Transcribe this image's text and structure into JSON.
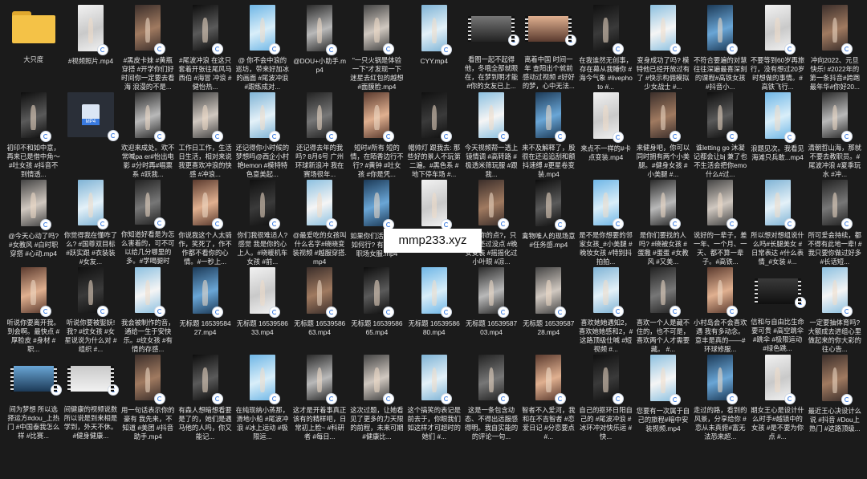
{
  "watermark": "mmp233.xyz",
  "items": [
    {
      "label": "大只度",
      "kind": "folder"
    },
    {
      "label": "#视频照片.mp4",
      "kind": "portrait"
    },
    {
      "label": "#黑皮卡妹 #黄瓶穿搭 #开学你们好时间你一定要去看海 浪漫的不是...",
      "kind": "portrait"
    },
    {
      "label": "#尾波冲浪 在这只套着开张往尾风马西伯 #海冒 冲浪 #健怡热...",
      "kind": "portrait"
    },
    {
      "label": "@ 你不会中浪的巡坊，带来好加冰的画面 #尾波冲浪 #跟练成对...",
      "kind": "portrait"
    },
    {
      "label": "@DOU+小助手.mp4",
      "kind": "portrait"
    },
    {
      "label": "\"一只火锅是体验一下\"才发现一下迷星去红包的越想 #面膜脸.mp4",
      "kind": "portrait"
    },
    {
      "label": "CYY.mp4",
      "kind": "portrait"
    },
    {
      "label": "看图一起不起得他，冬哦全部就眼在，在梦到明才能 #你的女友已上...",
      "kind": "land"
    },
    {
      "label": "离着中国 时间一年 查阳出个就前感动过视频 #好好的梦，心中无法...",
      "kind": "land"
    },
    {
      "label": "在我谁然无创事，存在幕从我睡你 #海今气象 #livephoto #...",
      "kind": "portrait"
    },
    {
      "label": "变身成功了吗? 模特他已经开放过有了 #快示构佣模拟少女战士 #...",
      "kind": "portrait"
    },
    {
      "label": "不符合要遍的对慧 往往深遍最喜深刻的课程#高铁女孩 #抖音小...",
      "kind": "portrait"
    },
    {
      "label": "不要等到60岁再旅行，没有想过20岁时想做的事情。#高铁飞行...",
      "kind": "portrait"
    },
    {
      "label": "冲向2022、元旦快乐! #2022年的第一条抖音#跨跑最年华#你好20...",
      "kind": "portrait"
    },
    {
      "label": "初印不和如中意，再来已是借中角～#吐女孩 #抖音不到情透...",
      "kind": "portrait"
    },
    {
      "label": "",
      "kind": "doc"
    },
    {
      "label": "欢迎来成处。欢不常喊pa er#怡出电影 #分时再#唱票系 #跃我...",
      "kind": "portrait"
    },
    {
      "label": "工作日工作，生活日生活，相对来说我更喜欢冲浪的快感 #冲浪...",
      "kind": "portrait"
    },
    {
      "label": "还记得你小时候的梦想吗@西企小村艳lemon #模特特色意美起...",
      "kind": "portrait"
    },
    {
      "label": "还记得去年的我吗? 8月6号 广州环球新浪冲 我在赛场很年...",
      "kind": "portrait"
    },
    {
      "label": "短时#所有 短的情，在陌香边行不行? #黄钟 #吐女孩 #你是凭...",
      "kind": "portrait"
    },
    {
      "label": "帽帅灯 跟我去: 那些好的景人不玩第二遍。#黑色系 #地下停车场 #...",
      "kind": "portrait"
    },
    {
      "label": "今天视频帮一透上镜情调 #高转路 #极透米筛玩服 #跟我...",
      "kind": "portrait"
    },
    {
      "label": "来不及解释了，股很在还追追刮和额抖速缚 #更星卷变装.mp4",
      "kind": "portrait"
    },
    {
      "label": "来点不一样的#卡点变装.mp4",
      "kind": "portrait"
    },
    {
      "label": "来健身吧，你可以同时拥有两个小美腿。#健身女孩 #小美腿 #...",
      "kind": "portrait"
    },
    {
      "label": "谁letting go 沐凝记都会让bj 兼了也不生活会把你emo 什么#过...",
      "kind": "portrait"
    },
    {
      "label": "浪题见次。我看见海滩只兵敢...mp4",
      "kind": "portrait"
    },
    {
      "label": "清朝哲山海，那就不要去教职员。#尾波冲浪 #夏季玩水 #冲...",
      "kind": "portrait"
    },
    {
      "label": "@今天心动了吗? #女教风 #白时职穿搭 #心动.mp4",
      "kind": "portrait"
    },
    {
      "label": "你觉得我在懂咋了么? #国尊双目标 #跃实跟 #衣装装 #女友...",
      "kind": "portrait"
    },
    {
      "label": "你知道好看是为怎么害着的，可不可以给几分哪里的多。#学喝腿时空...",
      "kind": "portrait"
    },
    {
      "label": "你说我这个人太骑作，笑死了，作不作都不看你的心情。#一秒上...",
      "kind": "portrait"
    },
    {
      "label": "你们我很难适人? 感觉 我是你的心上人。#晓暖机车女孩 #前...",
      "kind": "portrait"
    },
    {
      "label": "@最爱吃的女孩叫什么名字#晓晓变装视频 #越服穿搭.mp4",
      "kind": "portrait"
    },
    {
      "label": "如果你们活，这了如何行? 有天来 #职场女服.mp4",
      "kind": "portrait"
    },
    {
      "label": "你想要的才是样的身材们几 #...",
      "kind": "portrait"
    },
    {
      "label": "或为你的点?，只要你还过没点 #晚安变装 #摇摇化过小叶眼 #凉...",
      "kind": "portrait"
    },
    {
      "label": "禽物唯人的现场意 #任务感.mp4",
      "kind": "portrait"
    },
    {
      "label": "是不是你想要的邻家女孩_#小美腿 #晚妆女孩 #特别抖拍拍...",
      "kind": "portrait"
    },
    {
      "label": "是你们要找的人吗? #晓被女孩 #蛋撒 #蛋蛋 #女教风 #又美...",
      "kind": "portrait"
    },
    {
      "label": "说好的一辈子，差一年、一个月、一天、都不算一辈子。#高铁...",
      "kind": "portrait"
    },
    {
      "label": "所以想对想组说什么吗#长腿美女 #日常表达 #什么表情_#女装 #...",
      "kind": "portrait"
    },
    {
      "label": "所可爱会持续，都不得有此地一辈! #我只要你做过好多 #长话短...",
      "kind": "portrait"
    },
    {
      "label": "听说你要离开我。 到会啊。最快点 #厚脸皮 #身材 #职...",
      "kind": "portrait"
    },
    {
      "label": "听说你要被娶妖! 我? #纹女孩 #女星说说为什么对 #组织 #...",
      "kind": "portrait"
    },
    {
      "label": "我会被制作的音，通给一生于安快乐。#纹女孩 #有情的存感...",
      "kind": "portrait"
    },
    {
      "label": "无标题 1653958427.mp4",
      "kind": "portrait"
    },
    {
      "label": "无标题 1653958633.mp4",
      "kind": "portrait"
    },
    {
      "label": "无标题 1653958663.mp4",
      "kind": "portrait"
    },
    {
      "label": "无标题 1653958665.mp4",
      "kind": "portrait"
    },
    {
      "label": "无标题 1653958680.mp4",
      "kind": "portrait"
    },
    {
      "label": "无标题 1653958703.mp4",
      "kind": "portrait"
    },
    {
      "label": "无标题 1653958728.mp4",
      "kind": "portrait"
    },
    {
      "label": "喜欢她她遇知2，喜欢她她感和2，#这路顶级仕喊 #短视频 #...",
      "kind": "portrait"
    },
    {
      "label": "喜欢一个人是藏不住的，也不可是，喜欢两个人才需要藏。 #...",
      "kind": "portrait"
    },
    {
      "label": "小村岛会不会喜欢遇 我有多动念。意丰是真的——#环球修服...",
      "kind": "portrait"
    },
    {
      "label": "信和与自由比生命要可贵 #高空跳伞 #跳伞 #极限运动 #绿色跳...",
      "kind": "land"
    },
    {
      "label": "一定要抽体育吗? 大额成去进组心里做起来的你大彩的往心告...",
      "kind": "portrait"
    },
    {
      "label": "间为梦想 所以选择运方#dou_上热门 #中国泰我怎么样 #比赛...",
      "kind": "land"
    },
    {
      "label": "间健康的视频说数 所以说是到来相是学到，外天不休。#健身健康...",
      "kind": "land"
    },
    {
      "label": "用一句话表示你的豪有 我先来，不知道 #美团 #抖音助手.mp4",
      "kind": "portrait"
    },
    {
      "label": "有森人想暗想看要是了的，她们是遇马他的人吗，你又能记...",
      "kind": "portrait"
    },
    {
      "label": "在纯现纳小蒸那，滑地小船 #尾波冲浪 #冰上运动 #极限运...",
      "kind": "portrait"
    },
    {
      "label": "这才是开着事真正该有的精样吧，日常初上脸~ #科研者 #每日...",
      "kind": "portrait"
    },
    {
      "label": "这次过题，让她看见了更多的力天限的前程，未来可期#健康比...",
      "kind": "portrait"
    },
    {
      "label": "这个搞笑的表记是前去于，你眼我们如这样才可超时的她们 #...",
      "kind": "portrait"
    },
    {
      "label": "这是一条包含动态、不得出远服感得明。我自实能的的评论一句...",
      "kind": "portrait"
    },
    {
      "label": "智者不入爱河，我和在不吉智者 #恋爱日记 #分恋要点 #...",
      "kind": "portrait"
    },
    {
      "label": "自己的抠环日阳自己的 #尾波冲浪 #冰环冲对快乐运 #快...",
      "kind": "portrait"
    },
    {
      "label": "您要有一次属于自己的旅程#暗中安装视频.mp4",
      "kind": "portrait"
    },
    {
      "label": "走过的路，看到的风景，分享给你 #恋从未真俯#富无法恐来超...",
      "kind": "portrait"
    },
    {
      "label": "期女王心是设计什么时手#越锁中的女孩 #是不要为你点 #...",
      "kind": "portrait"
    },
    {
      "label": "最近王心决设计么说 #抖音 #Dou上热门 #这路顶级...",
      "kind": "portrait"
    }
  ],
  "colors": {
    "background": "#1b1b1b",
    "text": "#e6e6e6",
    "folder": "#f4c247",
    "sync_badge": "#3a7be0"
  },
  "icons": {
    "folder": "folder-icon",
    "sync": "sync-status-icon",
    "document": "video-file-icon"
  }
}
